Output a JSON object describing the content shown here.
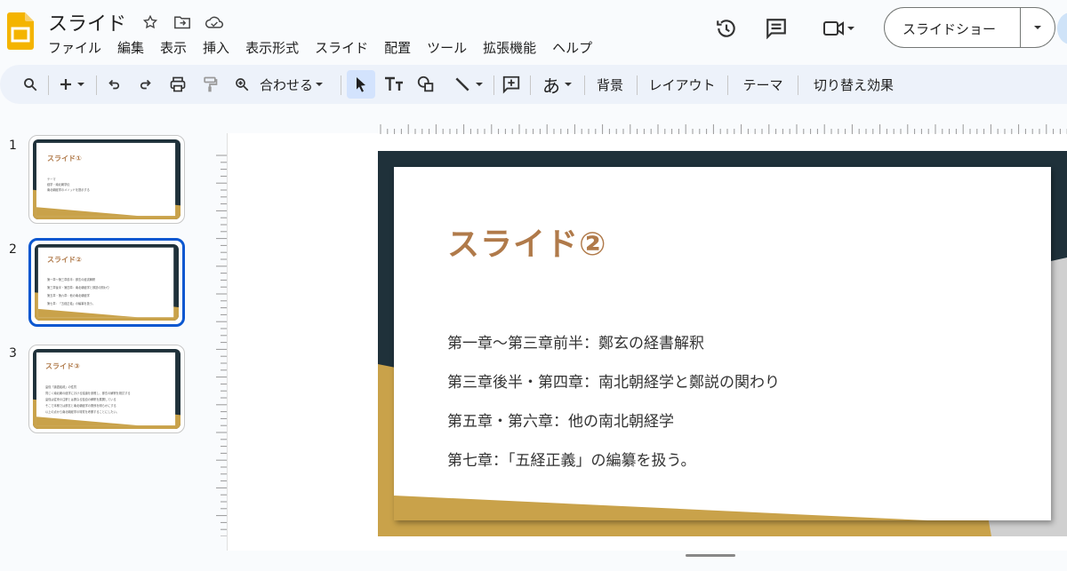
{
  "app": {
    "title": "スライド",
    "menu": [
      "ファイル",
      "編集",
      "表示",
      "挿入",
      "表示形式",
      "スライド",
      "配置",
      "ツール",
      "拡張機能",
      "ヘルプ"
    ],
    "slideshow_label": "スライドショー"
  },
  "toolbar": {
    "zoom_label": "合わせる",
    "text_style_label": "あ",
    "background_label": "背景",
    "layout_label": "レイアウト",
    "theme_label": "テーマ",
    "transition_label": "切り替え効果"
  },
  "filmstrip": {
    "slides": [
      {
        "number": "1",
        "title": "スライド①",
        "lines": [
          "テーマ",
          "経学・南北朝学伝",
          "南北朝経学のメソッドを提示する"
        ]
      },
      {
        "number": "2",
        "title": "スライド②",
        "lines": [
          "第一章～第三章前半：鄭玄の経書解釈",
          "第三章後半・第四章：南北朝経学と鄭説の関わり",
          "第五章・第六章：他の南北朝経学",
          "第七章：「五経正義」の編纂を扱う。"
        ]
      },
      {
        "number": "3",
        "title": "スライド③",
        "lines": [
          "皇侃「論語義疏」の性質",
          "同じく南北朝の経学における議論を参照し、鄭玄の解釈を検討する",
          "皇侃は従来の注釈とは異なる独自の解釈を展開している",
          "そこで本稿では鄭玄と南北朝経学の関係を明らかにする",
          "以上の点から南北朝経学の特質を考察することにしたい。"
        ]
      }
    ]
  },
  "slide": {
    "title": "スライド②",
    "lines": [
      "第一章～第三章前半：鄭玄の経書解釈",
      "第三章後半・第四章：南北朝経学と鄭説の関わり",
      "第五章・第六章：他の南北朝経学",
      "第七章：「五経正義」の編纂を扱う。"
    ]
  },
  "colors": {
    "accent": "#b07a4a",
    "dark": "#1f313a",
    "gold": "#c9a24a",
    "selection": "#0b57d0",
    "logo": "#f4b400"
  }
}
